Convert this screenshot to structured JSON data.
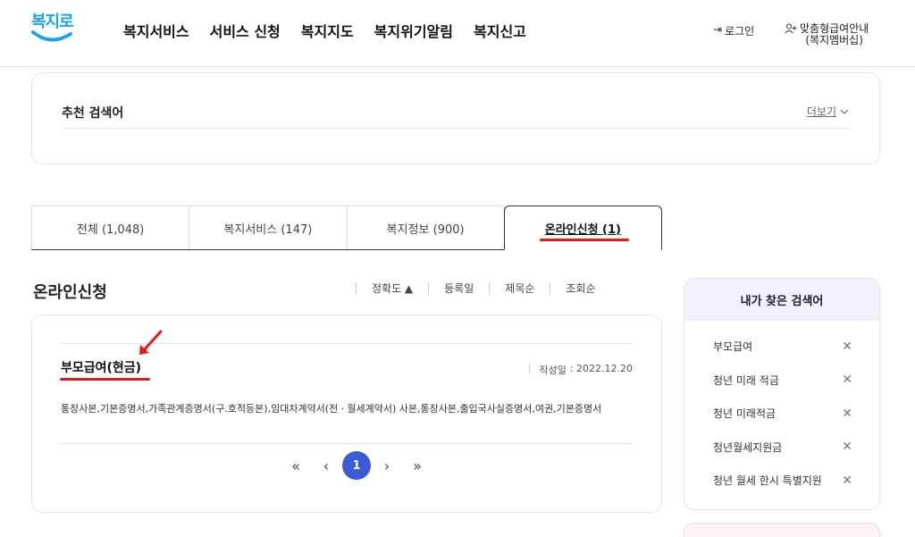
{
  "logo": {
    "text": "복지로",
    "brand_color": "#1aa3e8"
  },
  "nav": {
    "items": [
      "복지서비스",
      "서비스 신청",
      "복지지도",
      "복지위기알림",
      "복지신고"
    ]
  },
  "util": {
    "login_label": "로그인",
    "member_line1": "맞춤형급여안내",
    "member_line2": "(복지멤버십)"
  },
  "recommend": {
    "title": "추천 검색어",
    "more_label": "더보기"
  },
  "tabs": [
    {
      "label": "전체  (1,048)",
      "active": false
    },
    {
      "label": "복지서비스 (147)",
      "active": false
    },
    {
      "label": "복지정보 (900)",
      "active": false
    },
    {
      "label": "온라인신청 (1)",
      "active": true
    }
  ],
  "results": {
    "section_title": "온라인신청",
    "sort_options": [
      "정확도 ▲",
      "등록일",
      "제목순",
      "조회순"
    ],
    "item": {
      "title": "부모급여(현금)",
      "date_label": "작성일",
      "date_value": ": 2022.12.20",
      "description": "통장사본,기본증명서,가족관계증명서(구.호적등본),임대차계약서(전ㆍ월세계약서) 사본,통장사본,출입국사실증명서,여권,기본증명서"
    },
    "pager": {
      "first": "«",
      "prev": "‹",
      "current": "1",
      "next": "›",
      "last": "»"
    }
  },
  "sidebar": {
    "title": "내가 찾은 검색어",
    "items": [
      "부모급여",
      "청년 미래 적금",
      "청년 미래적금",
      "청년월세지원금",
      "청년 월세 한시 특별지원"
    ]
  },
  "colors": {
    "accent": "#3b5bd6",
    "annotation": "#e01b1b",
    "sidebar_head_bg": "#f3f0fb"
  }
}
